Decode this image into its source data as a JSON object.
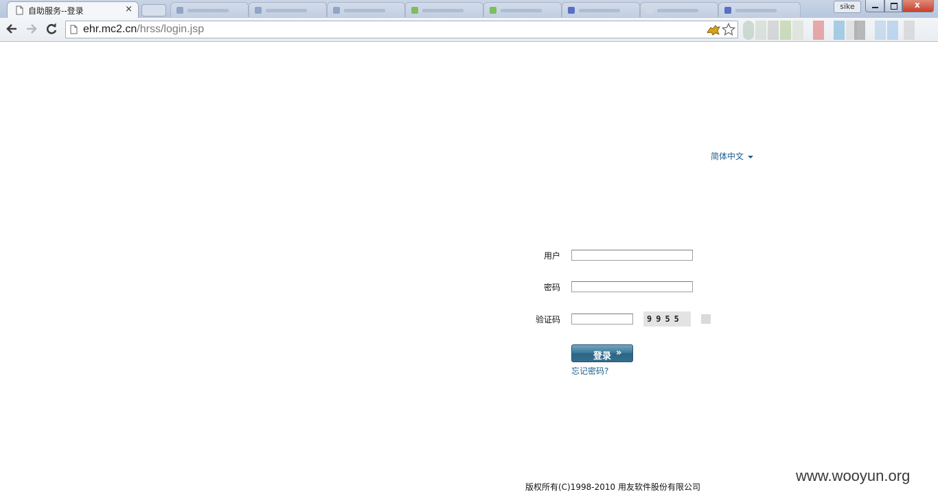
{
  "browser": {
    "tab_title": "自助服务--登录",
    "tab_close": "×",
    "user_badge": "sike",
    "window_close": "x",
    "url_host": "ehr.mc2.cn",
    "url_path": "/hrss/login.jsp"
  },
  "page": {
    "language": "简体中文",
    "labels": {
      "user": "用户",
      "password": "密码",
      "captcha": "验证码"
    },
    "captcha_code": "9955",
    "login_button": "登录",
    "forgot_password": "忘记密码?",
    "copyright": "版权所有(C)1998-2010 用友软件股份有限公司"
  },
  "watermark": "www.wooyun.org"
}
